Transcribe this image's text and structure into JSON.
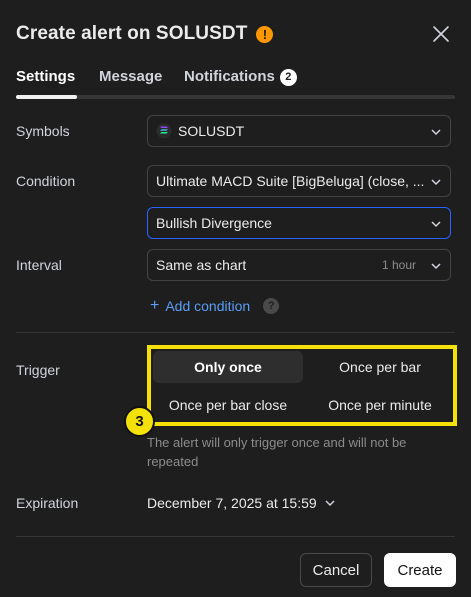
{
  "dialog": {
    "title": "Create alert on SOLUSDT",
    "warning_icon": "warning-icon",
    "warning_glyph": "!",
    "close_icon": "close-icon"
  },
  "tabs": [
    {
      "label": "Settings",
      "active": true
    },
    {
      "label": "Message",
      "active": false
    },
    {
      "label": "Notifications",
      "badge": "2",
      "active": false
    }
  ],
  "symbols": {
    "label": "Symbols",
    "value": "SOLUSDT",
    "icon": "solana-icon"
  },
  "condition": {
    "label": "Condition",
    "indicator": "Ultimate MACD Suite [BigBeluga] (close, ...",
    "signal": "Bullish Divergence"
  },
  "interval": {
    "label": "Interval",
    "value": "Same as chart",
    "hint": "1 hour"
  },
  "add_condition": {
    "label": "Add condition",
    "plus": "+",
    "help": "?"
  },
  "trigger": {
    "label": "Trigger",
    "options": [
      "Only once",
      "Once per bar",
      "Once per bar close",
      "Once per minute"
    ],
    "selected": "Only once",
    "description": "The alert will only trigger once and will not be repeated",
    "step_badge": "3"
  },
  "expiration": {
    "label": "Expiration",
    "value": "December 7, 2025 at 15:59"
  },
  "footer": {
    "cancel": "Cancel",
    "create": "Create"
  },
  "colors": {
    "accent": "#2962ff",
    "highlight": "#f5e10a",
    "warning": "#ff9800",
    "link": "#5b9cf6"
  }
}
